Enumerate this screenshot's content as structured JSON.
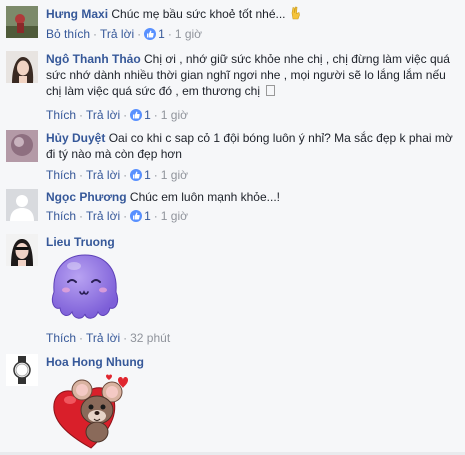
{
  "comments": [
    {
      "name": "Hưng Maxi",
      "text": "Chúc mẹ bầu sức khoẻ tốt nhé...",
      "emoji": "victory-hand-icon",
      "actions": {
        "like": "Bỏ thích",
        "reply": "Trả lời",
        "likes": "1",
        "time": "1 giờ"
      }
    },
    {
      "name": "Ngô Thanh Thảo",
      "text": "Chị ơi , nhớ giữ sức khỏe nhe chị , chị đừng làm việc quá sức nhớ dành nhiều thời gian nghĩ ngơi nhe , mọi người sẽ lo lắng lắm nếu chị làm việc quá sức đó , em thương chị",
      "actions": {
        "like": "Thích",
        "reply": "Trả lời",
        "likes": "1",
        "time": "1 giờ"
      }
    },
    {
      "name": "Hủy Duyệt",
      "text": "Oai co khi c sap cỏ 1 đội bóng luôn ý nhỉ? Ma sắc đẹp k phai mờ đi tý nào mà còn đẹp hơn",
      "actions": {
        "like": "Thích",
        "reply": "Trả lời",
        "likes": "1",
        "time": "1 giờ"
      }
    },
    {
      "name": "Ngọc Phương",
      "text": "Chúc em luôn mạnh khỏe...!",
      "actions": {
        "like": "Thích",
        "reply": "Trả lời",
        "likes": "1",
        "time": "1 giờ"
      }
    },
    {
      "name": "Lieu Truong",
      "sticker": "purple-octopus-sticker",
      "actions": {
        "like": "Thích",
        "reply": "Trả lời",
        "time": "32 phút"
      }
    },
    {
      "name": "Hoa Hong Nhung",
      "sticker": "mouse-heart-sticker"
    }
  ],
  "colors": {
    "link": "#365899",
    "meta": "#90949c",
    "like_badge": "#5890ff",
    "background": "#f6f7f9"
  }
}
